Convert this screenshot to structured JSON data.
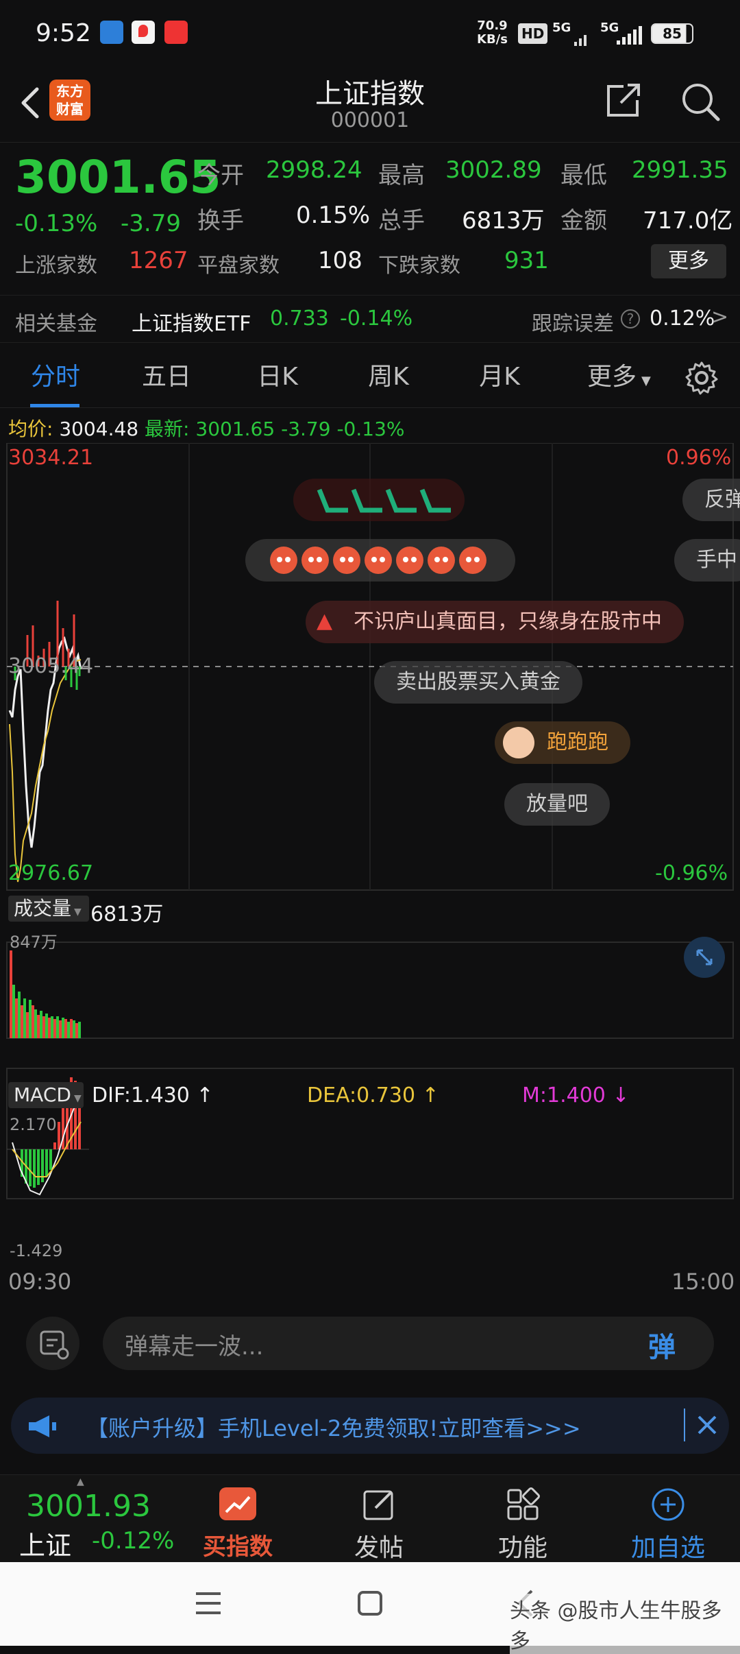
{
  "status": {
    "time": "9:52",
    "speed_top": "70.9",
    "speed_bottom": "KB/s",
    "hd": "HD",
    "net1": "5G",
    "net2": "5G",
    "battery": "85"
  },
  "nav": {
    "logo_line1": "东方",
    "logo_line2": "财富",
    "title": "上证指数",
    "code": "000001"
  },
  "quote": {
    "price": "3001.65",
    "change_pct": "-0.13%",
    "change": "-3.79",
    "open_label": "今开",
    "open": "2998.24",
    "high_label": "最高",
    "high": "3002.89",
    "low_label": "最低",
    "low": "2991.35",
    "turnover_label": "换手",
    "turnover": "0.15%",
    "volume_label": "总手",
    "volume": "6813万",
    "amount_label": "金额",
    "amount": "717.0亿",
    "up_label": "上涨家数",
    "up": "1267",
    "flat_label": "平盘家数",
    "flat": "108",
    "down_label": "下跌家数",
    "down": "931",
    "more": "更多"
  },
  "fund": {
    "label": "相关基金",
    "name": "上证指数ETF",
    "price": "0.733",
    "pct": "-0.14%",
    "track_label": "跟踪误差",
    "track_value": "0.12%"
  },
  "tabs": [
    "分时",
    "五日",
    "日K",
    "周K",
    "月K",
    "更多"
  ],
  "chart": {
    "avg_label": "均价:",
    "avg_value": "3004.48",
    "latest_label": "最新:",
    "latest_value": "3001.65",
    "latest_change": "-3.79",
    "latest_pct": "-0.13%",
    "top_price": "3034.21",
    "top_pct": "0.96%",
    "mid_price": "3005.44",
    "bottom_price": "2976.67",
    "bottom_pct": "-0.96%",
    "volume_label": "成交量",
    "volume_total": "6813万",
    "volume_max": "847万",
    "macd_label": "MACD",
    "dif": "DIF:1.430",
    "dea": "DEA:0.730",
    "m": "M:1.400",
    "macd_top": "2.170",
    "macd_bottom": "-1.429",
    "time_start": "09:30",
    "time_end": "15:00"
  },
  "danmu": {
    "d1": "不识庐山真面目，只缘身在股市中",
    "d2": "卖出股票买入黄金",
    "d3": "跑跑跑",
    "d4": "放量吧",
    "d5": "反弹",
    "d6": "手中"
  },
  "input": {
    "placeholder": "弹幕走一波...",
    "send": "弹"
  },
  "banner": {
    "text": "【账户升级】手机Level-2免费领取!立即查看>>>"
  },
  "bottom": {
    "index_price": "3001.93",
    "index_name": "上证",
    "index_pct": "-0.12%",
    "buy": "买指数",
    "post": "发帖",
    "func": "功能",
    "add": "加自选"
  },
  "watermark": "头条 @股市人生牛股多多",
  "colors": {
    "up": "#e8413a",
    "down": "#2bc73e",
    "accent": "#2f86e8",
    "avg_line": "#e9c53b"
  }
}
